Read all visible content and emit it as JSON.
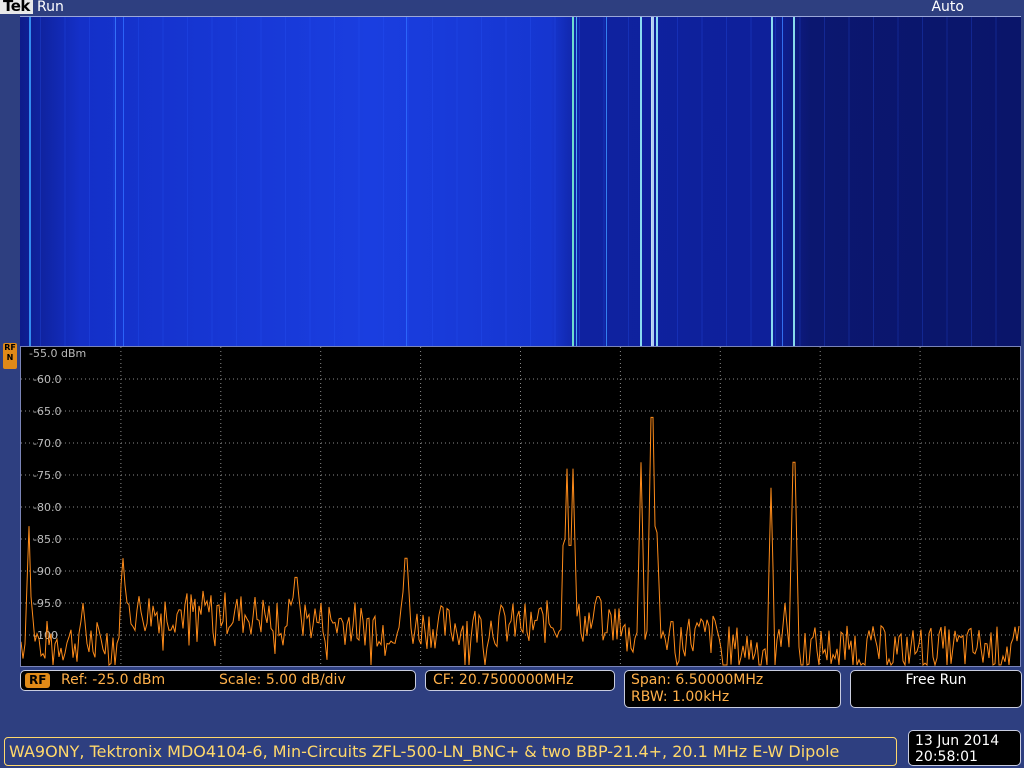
{
  "header": {
    "brand": "Tek",
    "run_status": "Run",
    "trigger_mode": "Auto"
  },
  "rf_marker": {
    "line1": "RF",
    "line2": "N"
  },
  "spectrum": {
    "ref_level_label": "-55.0 dBm",
    "y_ticks": [
      "-60.0",
      "-65.0",
      "-70.0",
      "-75.0",
      "-80.0",
      "-85.0",
      "-90.0",
      "-95.0",
      "-100"
    ],
    "trace_color": "#ff8c1a",
    "grid_color": "#8a8a8a"
  },
  "readouts": {
    "rf_badge": "RF",
    "ref": "Ref: -25.0 dBm",
    "scale": "Scale: 5.00 dB/div",
    "cf": "CF:  20.7500000MHz",
    "span": "Span:    6.50000MHz",
    "rbw": "RBW:     1.00kHz",
    "mode": "Free Run"
  },
  "footer": {
    "notes": "WA9ONY, Tektronix MDO4104-6, Min-Circuits ZFL-500-LN_BNC+ & two BBP-21.4+, 20.1 MHz E-W Dipole",
    "date": "13 Jun 2014",
    "time": "20:58:01"
  },
  "colors": {
    "background": "#2e3f80",
    "spectrogram": "#0a1a9a",
    "trace": "#ff8c1a",
    "accent_rf": "#e08a18"
  }
}
